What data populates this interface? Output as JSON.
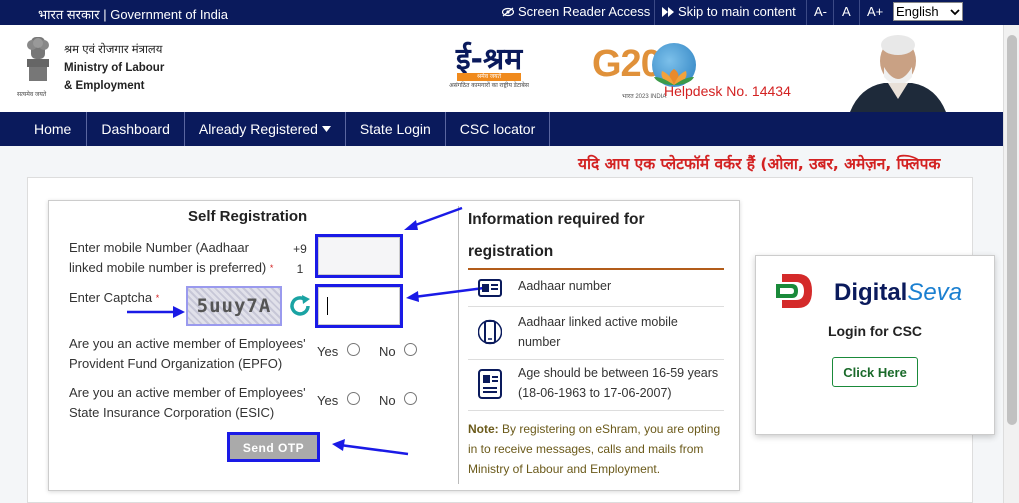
{
  "gov_bar": {
    "text": "भारत सरकार | Government of India",
    "screen_reader": "Screen Reader Access",
    "skip": "Skip to main content",
    "font_minus": "A-",
    "font_normal": "A",
    "font_plus": "A+",
    "language": "English"
  },
  "header": {
    "ministry_hi": "श्रम एवं रोजगार मंत्रालय",
    "ministry_en_1": "Ministry of Labour",
    "ministry_en_2": "& Employment",
    "eshram_logo": "ई-श्रम",
    "eshram_tagline": "श्रमेव जयते",
    "eshram_sub": "असंगठित कामगारों का राष्ट्रीय डेटाबेस",
    "g20_logo": "G20",
    "g20_year": "भारत 2023 INDIA",
    "helpdesk": "Helpdesk No. 14434",
    "emblem_caption": "सत्यमेव जयते"
  },
  "nav": {
    "items": [
      "Home",
      "Dashboard",
      "Already Registered",
      "State Login",
      "CSC locator"
    ]
  },
  "ticker": "यदि आप एक प्लेटफॉर्म वर्कर हैं (ओला, उबर, अमेज़न, फ्लिपक",
  "form": {
    "title": "Self Registration",
    "mobile_label_1": "Enter mobile Number (Aadhaar",
    "mobile_label_2": "linked mobile number is preferred)",
    "mobile_prefix_1": "+9",
    "mobile_prefix_2": "1",
    "mobile_value": "",
    "captcha_label": "Enter Captcha",
    "captcha_text": "5uuy7A",
    "captcha_value": "",
    "epfo_label_1": "Are you an active member of Employees'",
    "epfo_label_2": "Provident Fund Organization (EPFO)",
    "esic_label_1": "Are you an active member of Employees'",
    "esic_label_2": "State Insurance Corporation (ESIC)",
    "yes": "Yes",
    "no": "No",
    "send_otp": "Send OTP"
  },
  "info": {
    "title_1": "Information required for",
    "title_2": "registration",
    "items": [
      {
        "icon": "id-card-icon",
        "line1": "Aadhaar number",
        "line2": ""
      },
      {
        "icon": "mobile-phone-icon",
        "line1": "Aadhaar linked active mobile",
        "line2": "number"
      },
      {
        "icon": "id-card-icon",
        "line1": "Age should be between 16-59 years",
        "line2": "(18-06-1963 to 17-06-2007)"
      }
    ],
    "note_label": "Note:",
    "note_1": " By registering on eShram, you are opting",
    "note_2": "in to receive messages, calls and mails from",
    "note_3": "Ministry of Labour and Employment."
  },
  "csc": {
    "brand_1": "Digital",
    "brand_2": "Seva",
    "login": "Login for CSC",
    "button": "Click Here"
  },
  "colors": {
    "navy": "#0a1a5c",
    "highlight": "#1a1ae6",
    "helpdesk": "#d32222"
  }
}
